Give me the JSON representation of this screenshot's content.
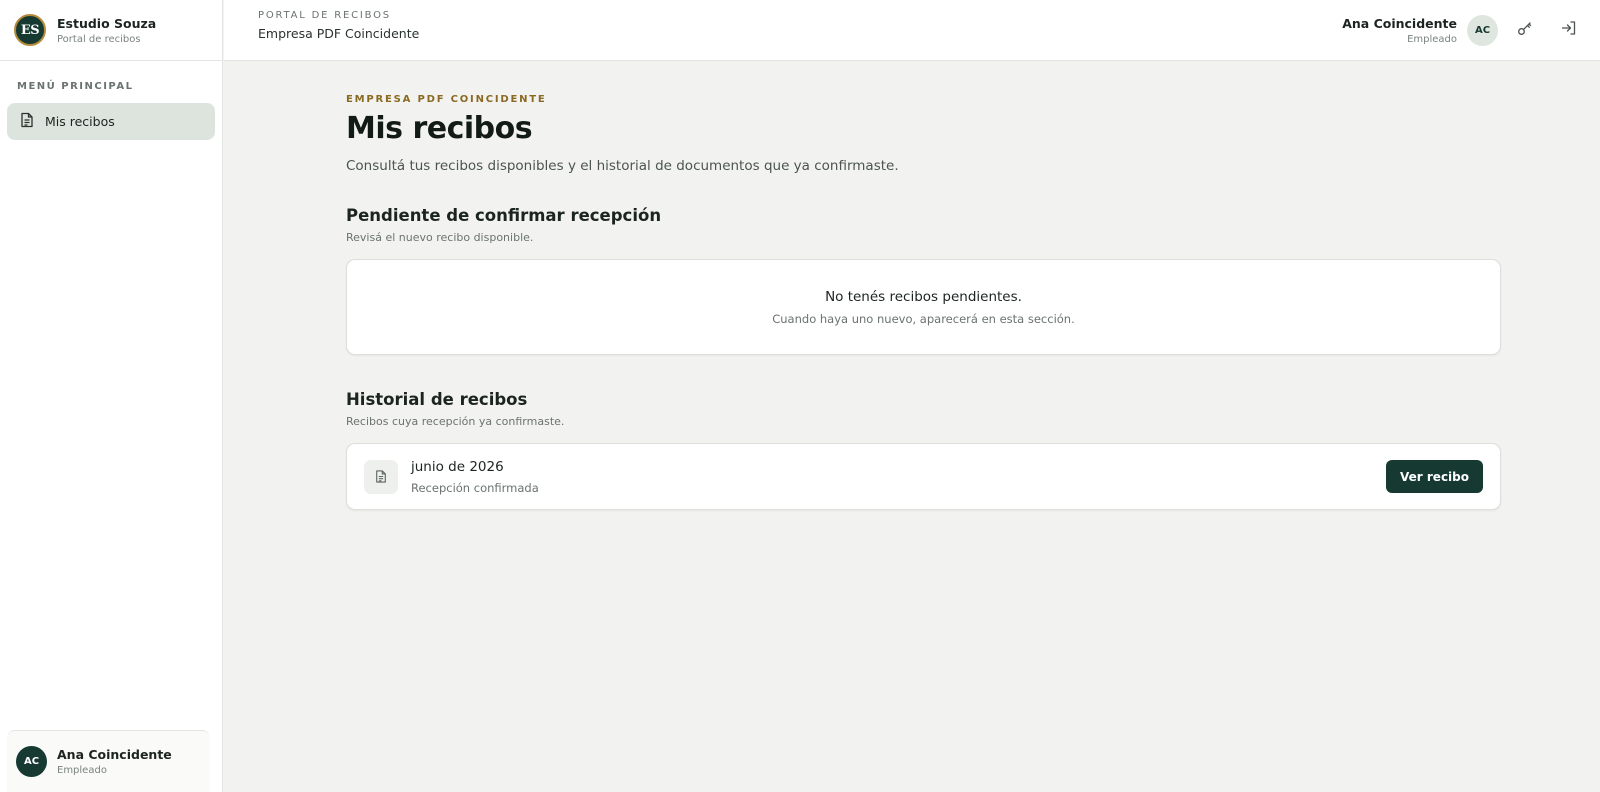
{
  "brand": {
    "logo_initials": "ES",
    "name": "Estudio Souza",
    "subtitle": "Portal de recibos"
  },
  "sidebar": {
    "menu_title": "MENÚ PRINCIPAL",
    "items": [
      {
        "label": "Mis recibos",
        "icon": "document-icon",
        "active": true
      }
    ],
    "user": {
      "initials": "AC",
      "name": "Ana Coincidente",
      "role": "Empleado"
    }
  },
  "header": {
    "kicker": "PORTAL DE RECIBOS",
    "company": "Empresa PDF Coincidente",
    "user": {
      "name": "Ana Coincidente",
      "role": "Empleado",
      "initials": "AC"
    },
    "actions": [
      {
        "icon": "key-icon"
      },
      {
        "icon": "logout-icon"
      }
    ]
  },
  "main": {
    "kicker": "EMPRESA PDF COINCIDENTE",
    "title": "Mis recibos",
    "description": "Consultá tus recibos disponibles y el historial de documentos que ya confirmaste.",
    "pending": {
      "title": "Pendiente de confirmar recepción",
      "subtitle": "Revisá el nuevo recibo disponible.",
      "empty_title": "No tenés recibos pendientes.",
      "empty_subtitle": "Cuando haya uno nuevo, aparecerá en esta sección."
    },
    "history": {
      "title": "Historial de recibos",
      "subtitle": "Recibos cuya recepción ya confirmaste.",
      "items": [
        {
          "period": "junio de 2026",
          "status": "Recepción confirmada",
          "button_label": "Ver recibo"
        }
      ]
    }
  },
  "colors": {
    "brand_dark": "#163a32",
    "accent_gold": "#8a6a22",
    "active_menu_bg": "#dde4dd",
    "page_bg": "#f2f3f1"
  }
}
